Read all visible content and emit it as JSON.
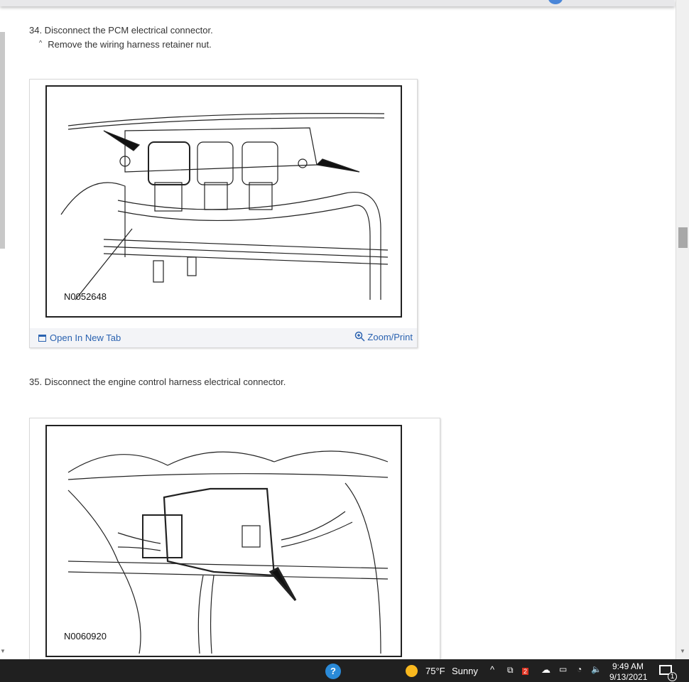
{
  "steps": [
    {
      "text": "34. Disconnect the PCM electrical connector.",
      "sub": "Remove the wiring harness retainer nut.",
      "sub_marker": "^",
      "figure_id": "N0052648",
      "open_label": "Open In New Tab",
      "zoom_label": "Zoom/Print"
    },
    {
      "text": "35. Disconnect the engine control harness electrical connector.",
      "figure_id": "N0060920"
    }
  ],
  "taskbar": {
    "weather_temp": "75°F",
    "weather_text": "Sunny",
    "time": "9:49 AM",
    "date": "9/13/2021",
    "dropbox_badge": "2",
    "notification_count": "1"
  },
  "colors": {
    "link": "#2a62b0",
    "taskbar": "#202020"
  }
}
